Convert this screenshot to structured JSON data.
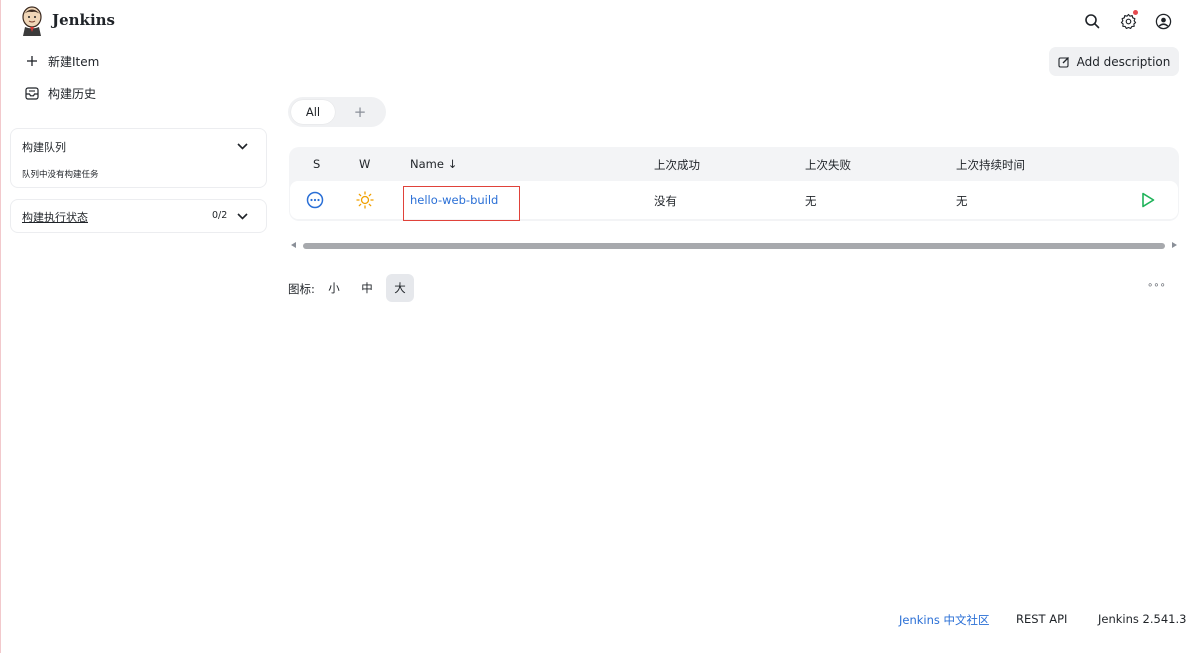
{
  "header": {
    "brand": "Jenkins"
  },
  "sidebar": {
    "new_item": "新建Item",
    "build_history": "构建历史",
    "build_queue": {
      "title": "构建队列",
      "empty_text": "队列中没有构建任务"
    },
    "executor_status": {
      "title": "构建执行状态",
      "count": "0/2"
    }
  },
  "main": {
    "add_description": "Add description",
    "tabs": [
      {
        "label": "All"
      },
      {
        "label": "+"
      }
    ],
    "table": {
      "columns": [
        "S",
        "W",
        "Name ↓",
        "上次成功",
        "上次失败",
        "上次持续时间"
      ],
      "rows": [
        {
          "status_icon": "in-progress-icon",
          "weather_icon": "sunny-icon",
          "name": "hello-web-build",
          "last_success": "没有",
          "last_failure": "无",
          "last_duration": "无"
        }
      ]
    },
    "icon_size": {
      "label": "图标:",
      "options": [
        "小",
        "中",
        "大"
      ],
      "selected": "大"
    },
    "more": "∘∘∘"
  },
  "footer": {
    "community": "Jenkins 中文社区",
    "rest_api": "REST API",
    "version": "Jenkins 2.541.3"
  },
  "colors": {
    "link": "#2a6fd6",
    "run": "#1fb35a",
    "weather": "#f0a000",
    "highlight": "#e0423a"
  }
}
